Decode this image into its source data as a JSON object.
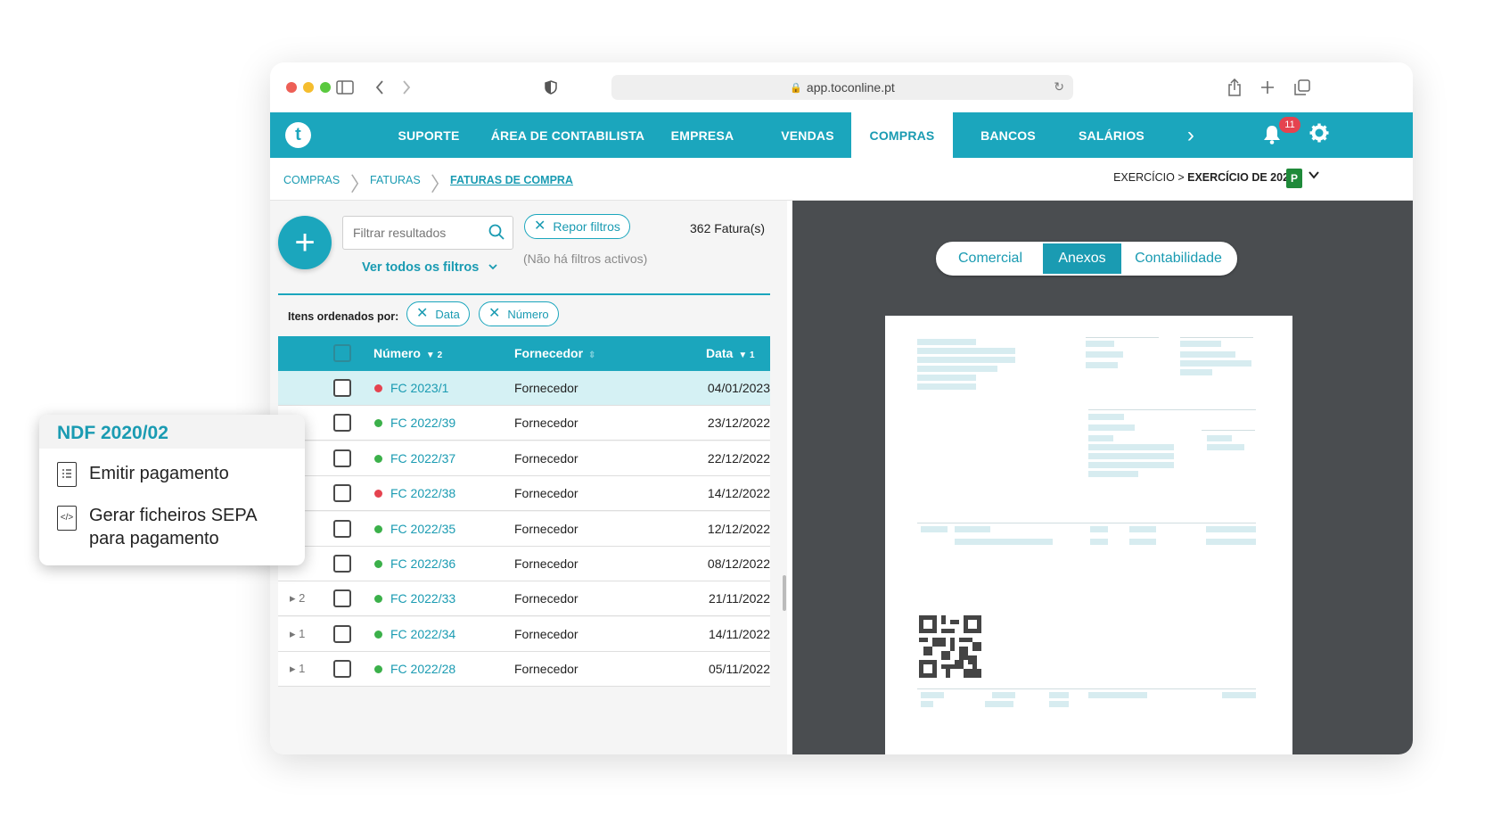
{
  "browser": {
    "url": "app.toconline.pt"
  },
  "nav": {
    "logo": "t",
    "items": [
      {
        "label": "SUPORTE"
      },
      {
        "label": "ÁREA DE CONTABILISTA"
      },
      {
        "label": "EMPRESA"
      },
      {
        "label": "VENDAS"
      },
      {
        "label": "COMPRAS",
        "active": true
      },
      {
        "label": "BANCOS"
      },
      {
        "label": "SALÁRIOS"
      }
    ],
    "more": "›",
    "notifications": "11"
  },
  "breadcrumb": {
    "items": [
      "COMPRAS",
      "FATURAS",
      "FATURAS DE COMPRA"
    ],
    "exercise_prefix": "EXERCÍCIO > ",
    "exercise_value": "EXERCÍCIO DE 2022",
    "exercise_badge": "P"
  },
  "filters": {
    "add": "+",
    "placeholder": "Filtrar resultados",
    "all_filters": "Ver todos os filtros",
    "reset": "Repor filtros",
    "none_active": "(Não há filtros activos)",
    "count": "362 Fatura(s)"
  },
  "ordering": {
    "label": "Itens ordenados por:",
    "chips": [
      "Data",
      "Número"
    ]
  },
  "table": {
    "columns": {
      "number": "Número",
      "number_sort": "2",
      "supplier": "Fornecedor",
      "date": "Data",
      "date_sort": "1"
    },
    "rows": [
      {
        "expand": "",
        "number": "FC 2023/1",
        "status": "red",
        "supplier": "Fornecedor",
        "date": "04/01/2023"
      },
      {
        "expand": "",
        "number": "FC 2022/39",
        "status": "green",
        "supplier": "Fornecedor",
        "date": "23/12/2022"
      },
      {
        "expand": "",
        "number": "FC 2022/37",
        "status": "green",
        "supplier": "Fornecedor",
        "date": "22/12/2022"
      },
      {
        "expand": "",
        "number": "FC 2022/38",
        "status": "red",
        "supplier": "Fornecedor",
        "date": "14/12/2022"
      },
      {
        "expand": "",
        "number": "FC 2022/35",
        "status": "green",
        "supplier": "Fornecedor",
        "date": "12/12/2022"
      },
      {
        "expand": "",
        "number": "FC 2022/36",
        "status": "green",
        "supplier": "Fornecedor",
        "date": "08/12/2022"
      },
      {
        "expand": "▸ 2",
        "number": "FC 2022/33",
        "status": "green",
        "supplier": "Fornecedor",
        "date": "21/11/2022"
      },
      {
        "expand": "▸ 1",
        "number": "FC 2022/34",
        "status": "green",
        "supplier": "Fornecedor",
        "date": "14/11/2022"
      },
      {
        "expand": "▸ 1",
        "number": "FC 2022/28",
        "status": "green",
        "supplier": "Fornecedor",
        "date": "05/11/2022"
      }
    ]
  },
  "viewer": {
    "tabs": [
      "Comercial",
      "Anexos",
      "Contabilidade"
    ],
    "active_tab": "Anexos"
  },
  "popup": {
    "title": "NDF 2020/02",
    "items": [
      "Emitir pagamento",
      "Gerar ficheiros SEPA para pagamento"
    ]
  },
  "colors": {
    "brand": "#1ba6bd",
    "status_red": "#e5434f",
    "status_green": "#3bb04a"
  }
}
